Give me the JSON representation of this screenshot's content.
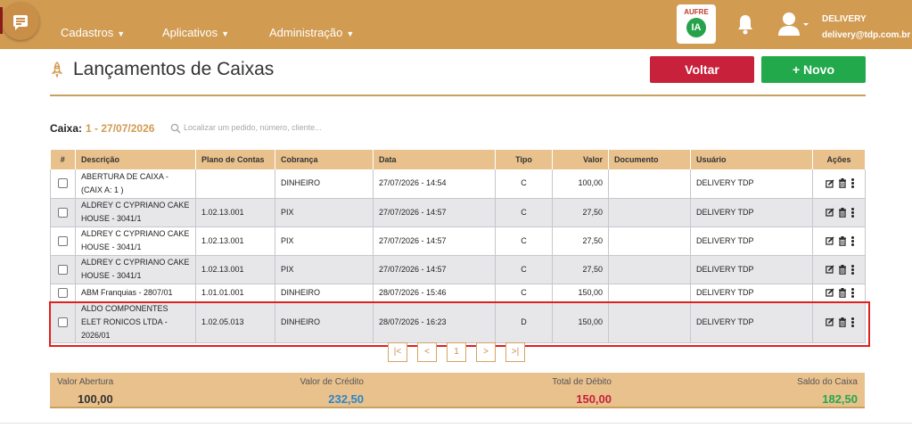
{
  "nav": {
    "items": [
      {
        "label": "Cadastros"
      },
      {
        "label": "Aplicativos"
      },
      {
        "label": "Administração"
      }
    ],
    "aufre_label": "AUFRE",
    "ia_label": "IA",
    "user_name": "DELIVERY",
    "user_email": "delivery@tdp.com.br"
  },
  "page": {
    "title": "Lançamentos de Caixas",
    "back_label": "Voltar",
    "new_label": "+ Novo"
  },
  "caixa": {
    "label": "Caixa:",
    "value": "1 - 27/07/2026"
  },
  "search": {
    "placeholder": "Localizar um pedido, número, cliente..."
  },
  "table": {
    "headers": [
      "#",
      "Descrição",
      "Plano de Contas",
      "Cobrança",
      "Data",
      "Tipo",
      "Valor",
      "Documento",
      "Usuário",
      "Ações"
    ],
    "rows": [
      {
        "descricao": "ABERTURA DE CAIXA - (CAIX A: 1 )",
        "plano": "",
        "cobranca": "DINHEIRO",
        "data": "27/07/2026 - 14:54",
        "tipo": "C",
        "valor": "100,00",
        "documento": "",
        "usuario": "DELIVERY TDP"
      },
      {
        "descricao": "ALDREY C CYPRIANO CAKE HOUSE - 3041/1",
        "plano": "1.02.13.001",
        "cobranca": "PIX",
        "data": "27/07/2026 - 14:57",
        "tipo": "C",
        "valor": "27,50",
        "documento": "",
        "usuario": "DELIVERY TDP"
      },
      {
        "descricao": "ALDREY C CYPRIANO CAKE HOUSE - 3041/1",
        "plano": "1.02.13.001",
        "cobranca": "PIX",
        "data": "27/07/2026 - 14:57",
        "tipo": "C",
        "valor": "27,50",
        "documento": "",
        "usuario": "DELIVERY TDP"
      },
      {
        "descricao": "ALDREY C CYPRIANO CAKE HOUSE - 3041/1",
        "plano": "1.02.13.001",
        "cobranca": "PIX",
        "data": "27/07/2026 - 14:57",
        "tipo": "C",
        "valor": "27,50",
        "documento": "",
        "usuario": "DELIVERY TDP"
      },
      {
        "descricao": "ABM Franquias - 2807/01",
        "plano": "1.01.01.001",
        "cobranca": "DINHEIRO",
        "data": "28/07/2026 - 15:46",
        "tipo": "C",
        "valor": "150,00",
        "documento": "",
        "usuario": "DELIVERY TDP"
      },
      {
        "descricao": "ALDO COMPONENTES ELET RONICOS LTDA - 2026/01",
        "plano": "1.02.05.013",
        "cobranca": "DINHEIRO",
        "data": "28/07/2026 - 16:23",
        "tipo": "D",
        "valor": "150,00",
        "documento": "",
        "usuario": "DELIVERY TDP"
      }
    ]
  },
  "pagination": {
    "first": "|<",
    "prev": "<",
    "page": "1",
    "next": ">",
    "last": ">|"
  },
  "totals": {
    "abertura_label": "Valor Abertura",
    "abertura_value": "100,00",
    "credito_label": "Valor de Crédito",
    "credito_value": "232,50",
    "debito_label": "Total de Débito",
    "debito_value": "150,00",
    "saldo_label": "Saldo do Caixa",
    "saldo_value": "182,50"
  },
  "colors": {
    "brand": "#d19b52",
    "back_button": "#c8213c",
    "new_button": "#22a94c",
    "credit": "#2a86c8",
    "debit": "#c8213c",
    "balance": "#22a94c"
  }
}
